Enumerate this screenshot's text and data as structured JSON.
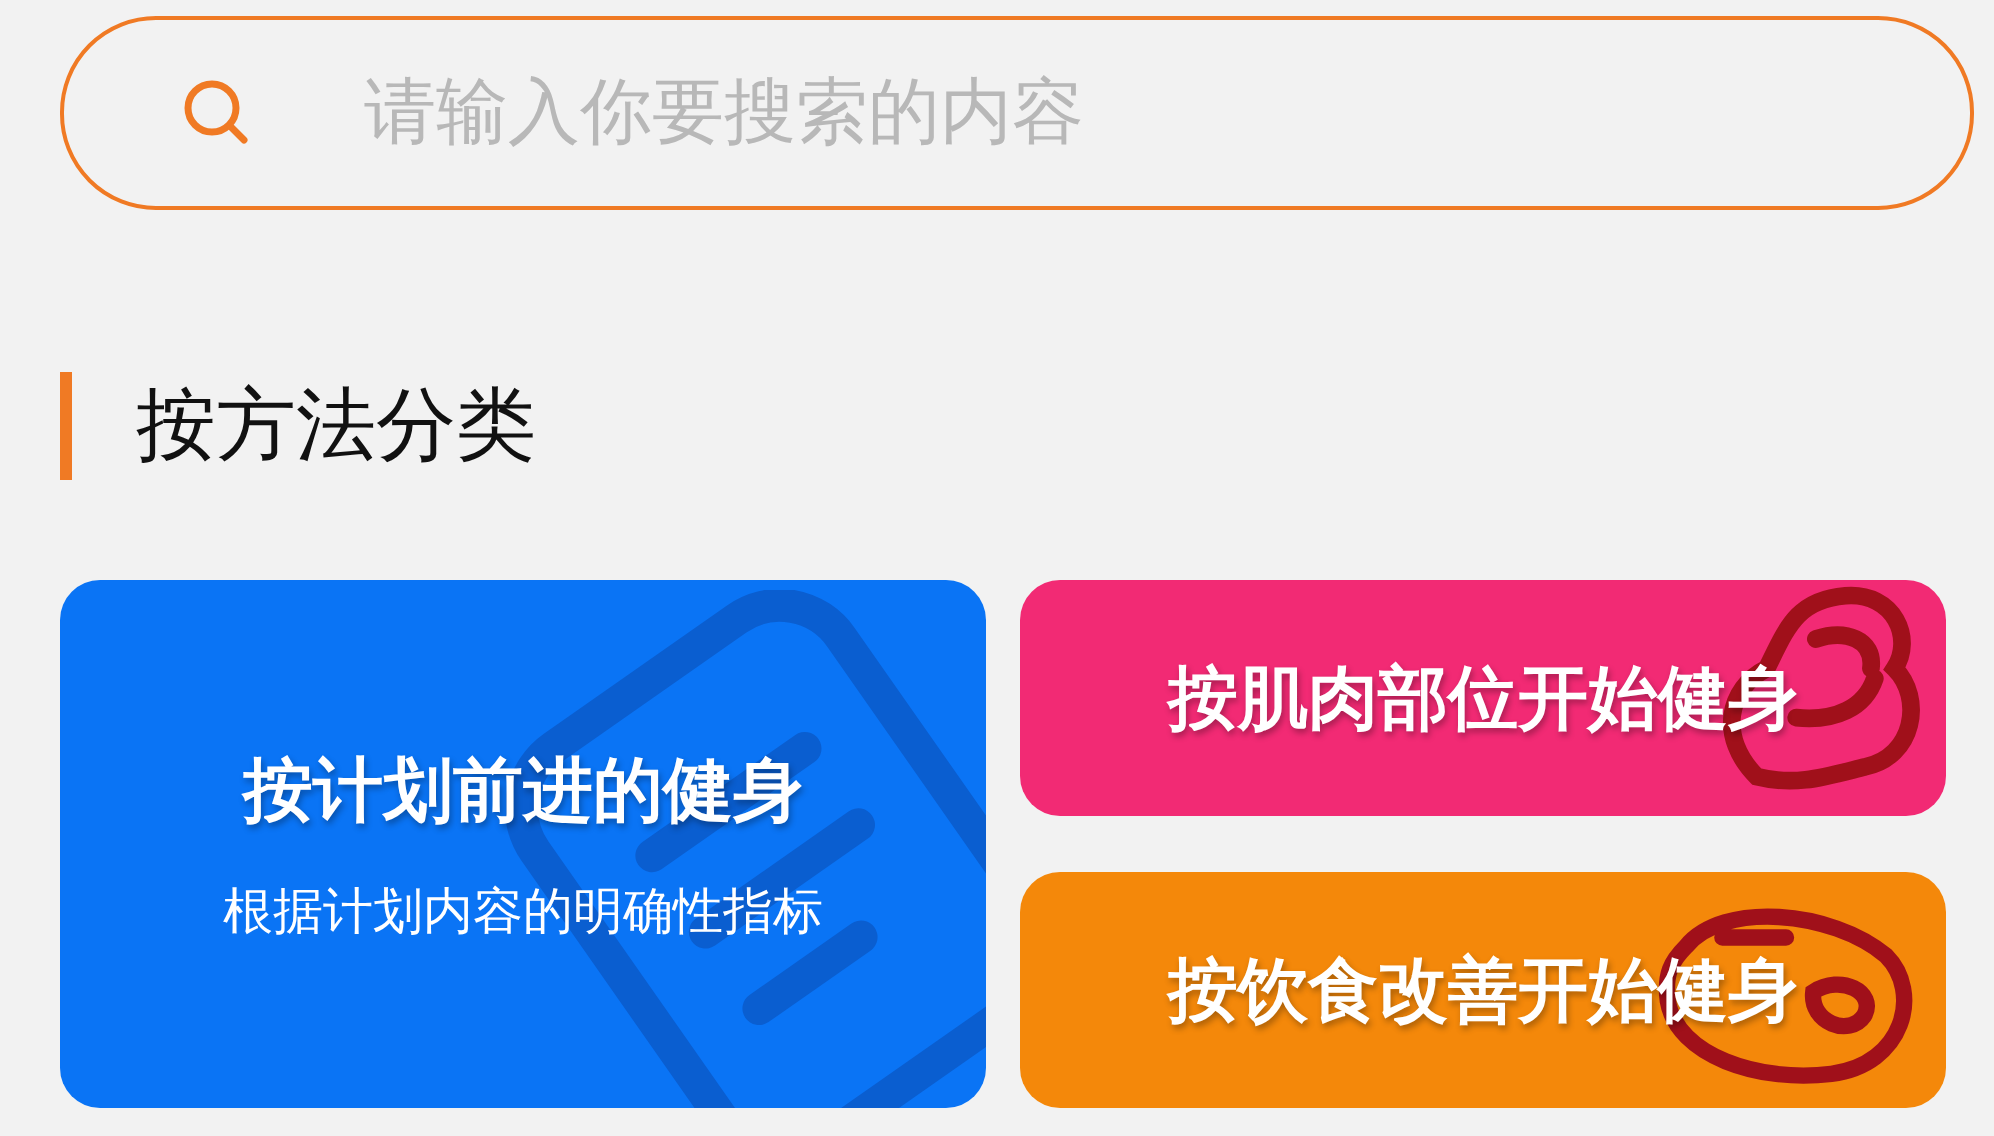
{
  "search": {
    "placeholder": "请输入你要搜索的内容"
  },
  "section": {
    "title": "按方法分类"
  },
  "cards": [
    {
      "kind": "plan",
      "title": "按计划前进的健身",
      "subtitle": "根据计划内容的明确性指标",
      "color": "#0a74f5"
    },
    {
      "kind": "muscle",
      "title": "按肌肉部位开始健身",
      "color": "#f22a74"
    },
    {
      "kind": "diet",
      "title": "按饮食改善开始健身",
      "color": "#f4880a"
    }
  ]
}
